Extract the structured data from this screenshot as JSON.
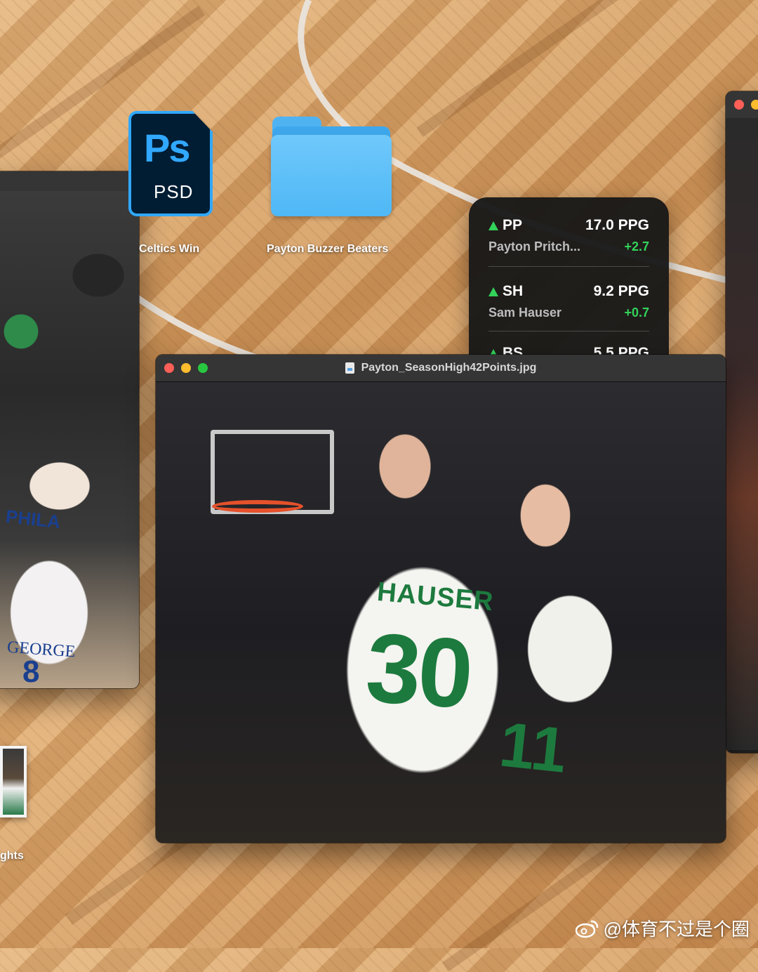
{
  "desktop": {
    "icons": [
      {
        "label": "Celtics Win"
      },
      {
        "label": "Payton Buzzer Beaters"
      },
      {
        "label": "ghts"
      }
    ],
    "ps_icon": {
      "badge_text": "Ps",
      "ext_text": "PSD",
      "label": "Celtics Win"
    },
    "folder_icon": {
      "label": "Payton Buzzer Beaters"
    },
    "thumb_icon": {
      "label": "ghts"
    }
  },
  "stocks_widget": {
    "rows": [
      {
        "symbol": "PP",
        "price": "17.0 PPG",
        "name": "Payton Pritch...",
        "change": "+2.7",
        "trend": "up"
      },
      {
        "symbol": "SH",
        "price": "9.2 PPG",
        "name": "Sam Hauser",
        "change": "+0.7",
        "trend": "up"
      },
      {
        "symbol": "BS",
        "price": "5.5 PPG",
        "name": "",
        "change": "",
        "trend": "up"
      }
    ],
    "up_color": "#33d35a"
  },
  "main_window": {
    "title": "Payton_SeasonHigh42Points.jpg",
    "photo": {
      "jersey_name": "HAUSER",
      "jersey_number": "30",
      "jersey_number_2": "11"
    }
  },
  "left_window": {
    "photo_texts": [
      "PHILA",
      "GEORGE",
      "8"
    ]
  },
  "watermark": {
    "text": "@体育不过是个圈"
  },
  "colors": {
    "traffic_red": "#ff5f57",
    "traffic_yellow": "#febc2e",
    "traffic_green": "#28c840",
    "ps_blue": "#31a8ff",
    "ps_bg": "#001d34",
    "folder_blue": "#5ab9f6",
    "celtics_green": "#1d7a3e"
  }
}
